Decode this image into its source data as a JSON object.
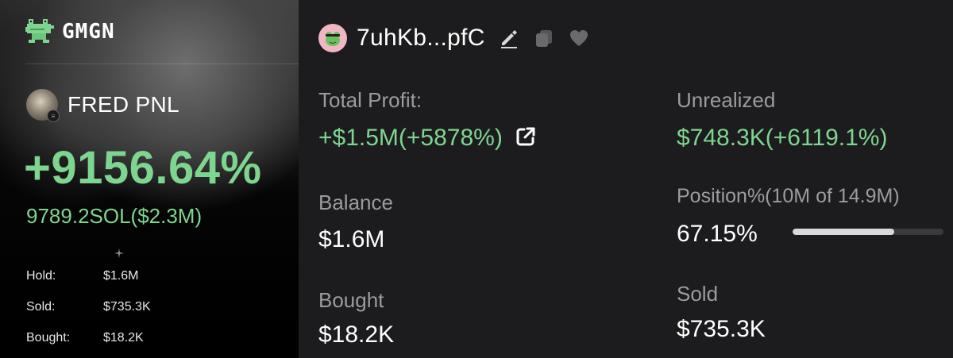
{
  "card": {
    "brand": "GMGN",
    "brand_logo": "pixel-frog-logo",
    "pnl_title": "FRED PNL",
    "pnl_percent": "+9156.64%",
    "pnl_sol": "9789.2SOL($2.3M)",
    "stats": [
      {
        "label": "Hold:",
        "value": "$1.6M"
      },
      {
        "label": "Sold:",
        "value": "$735.3K"
      },
      {
        "label": "Bought:",
        "value": "$18.2K"
      }
    ],
    "accent_color": "#7ed58f"
  },
  "panel": {
    "wallet_address": "7uhKb...pfC",
    "icons": [
      "edit-icon",
      "copy-icon",
      "heart-icon"
    ],
    "total_profit_label": "Total Profit:",
    "total_profit_value": "+$1.5M(+5878%)",
    "unrealized_label": "Unrealized",
    "unrealized_value": "$748.3K(+6119.1%)",
    "balance_label": "Balance",
    "balance_value": "$1.6M",
    "position_label": "Position%(10M of 14.9M)",
    "position_value": "67.15%",
    "position_fraction": 0.6715,
    "bought_label": "Bought",
    "bought_value": "$18.2K",
    "sold_label": "Sold",
    "sold_value": "$735.3K",
    "profit_color": "#7ed58f",
    "label_color": "#9b9ba1"
  }
}
